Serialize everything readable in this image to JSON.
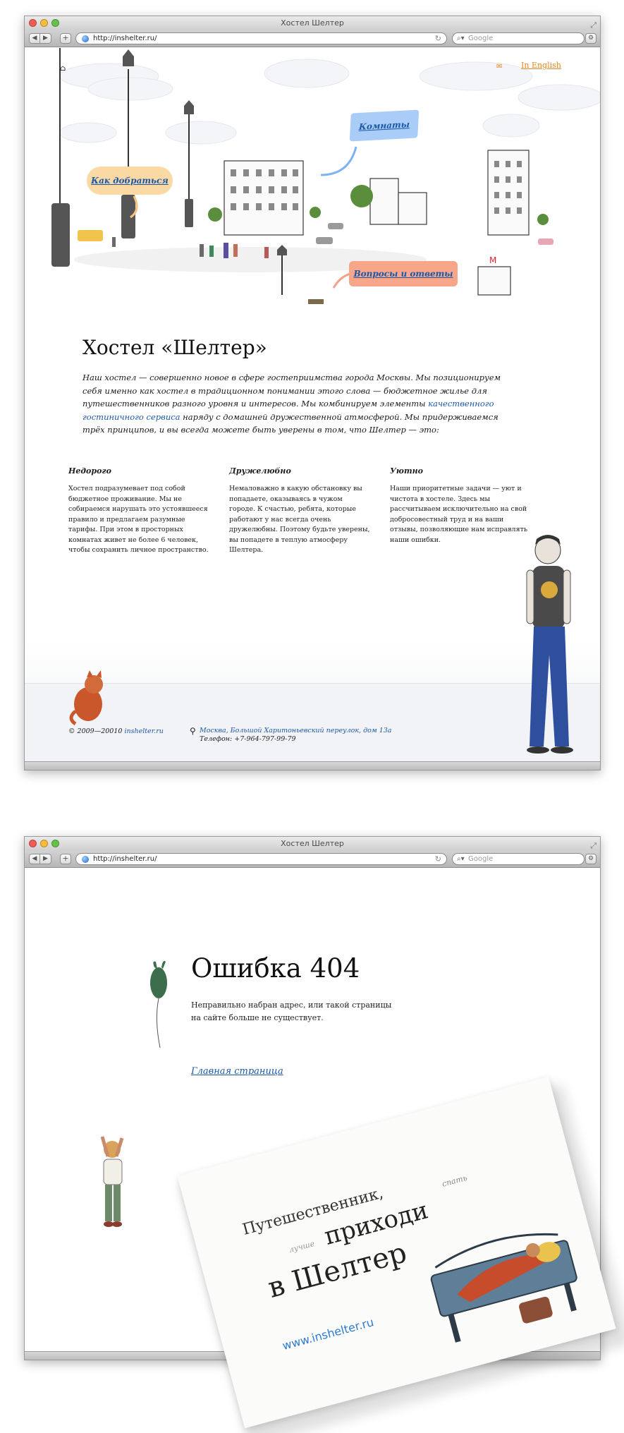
{
  "browser": {
    "title": "Хостел Шелтер",
    "url": "http://inshelter.ru/",
    "search_placeholder": "Google"
  },
  "home": {
    "lang_link": "In English",
    "bubbles": {
      "how_to_get": "Как добраться",
      "rooms": "Комнаты",
      "faq": "Вопросы и ответы"
    },
    "title": "Хостел «Шелтер»",
    "intro_before_link": "Наш хостел — совершенно новое в сфере гостеприимства города Москвы. Мы позиционируем себя именно как хостел в традиционном понимании этого слова — бюджетное жилье для путешественников разного уровня и интересов. Мы комбинируем элементы ",
    "intro_link": "качественного гостиничного сервиса",
    "intro_after_link": " наряду с домашней дружественной атмосферой. Мы придерживаемся трёх принципов, и вы всегда можете быть уверены в том, что Шелтер — это:",
    "principles": [
      {
        "heading": "Недорого",
        "text": "Хостел подразумевает под собой бюджетное проживание. Мы не собираемся нарушать это устоявшееся правило и предлагаем разумные тарифы. При этом в просторных комнатах живет не более 6 человек, чтобы сохранить личное пространство."
      },
      {
        "heading": "Дружелюбно",
        "text": "Немаловажно в какую обстановку вы попадаете, оказываясь в чужом городе. К счастью, ребята, которые работают у нас всегда очень дружелюбны. Поэтому будьте уверены, вы попадете в теплую атмосферу Шелтера."
      },
      {
        "heading": "Уютно",
        "text": "Наши приоритетные задачи — уют и чистота в хостеле. Здесь мы рассчитываем исключительно на свой добросовестный труд и на ваши отзывы, позволяющие нам исправлять наши ошибки."
      }
    ],
    "footer": {
      "copyright_text": "© 2009—20010 ",
      "copyright_link": "inshelter.ru",
      "address_link": "Москва, Большой Харитоньевский переулок, дом 13а",
      "phone": "Телефон: +7-964-797-99-79"
    }
  },
  "error_page": {
    "title": "Ошибка 404",
    "message": "Неправильно набран адрес, или такой страницы на сайте больше не существует.",
    "home_link": "Главная страница"
  },
  "postcard": {
    "line1": "Путешественник,",
    "line2": "приходи",
    "word_sleep": "спать",
    "word_better": "лучше",
    "line3": "в Шелтер",
    "url": "www.inshelter.ru"
  },
  "colors": {
    "link": "#1b57a7",
    "accent_orange": "#e2851c",
    "bubble_how": "#fbd9a5",
    "bubble_rooms": "#a9cdf7",
    "bubble_faq": "#f7a689"
  }
}
